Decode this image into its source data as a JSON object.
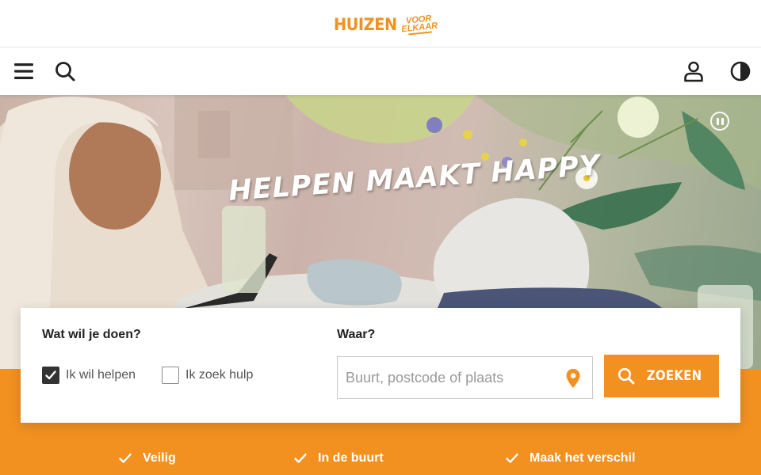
{
  "brand": {
    "logo_main": "HUIZEN",
    "logo_sub_1": "VOOR",
    "logo_sub_2": "ELKAAR",
    "accent_color": "#f29120"
  },
  "nav": {
    "menu_icon": "hamburger-menu-icon",
    "search_icon": "search-icon",
    "account_icon": "user-icon",
    "contrast_icon": "contrast-icon"
  },
  "hero": {
    "title": "HELPEN MAAKT HAPPY",
    "pause_icon": "pause-icon"
  },
  "search": {
    "what_label": "Wat wil je doen?",
    "where_label": "Waar?",
    "options": [
      {
        "label": "Ik wil helpen",
        "checked": true
      },
      {
        "label": "Ik zoek hulp",
        "checked": false
      }
    ],
    "location_placeholder": "Buurt, postcode of plaats",
    "location_value": "",
    "location_icon": "map-pin-icon",
    "button_label": "ZOEKEN"
  },
  "usps": [
    {
      "label": "Veilig",
      "icon": "check-icon"
    },
    {
      "label": "In de buurt",
      "icon": "check-icon"
    },
    {
      "label": "Maak het verschil",
      "icon": "check-icon"
    }
  ]
}
